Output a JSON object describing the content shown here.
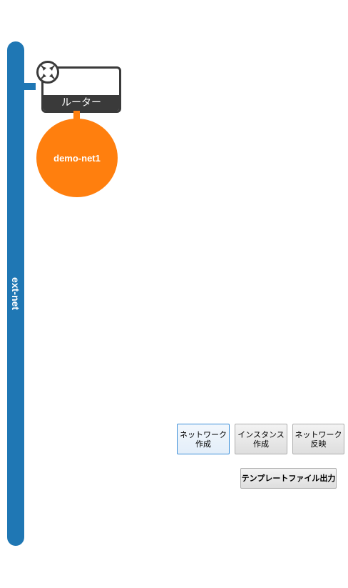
{
  "topology": {
    "external_network": {
      "name": "ext-net",
      "color": "#1f77b4"
    },
    "router": {
      "label": "ルーター",
      "icon": "router-arrows-icon"
    },
    "networks": [
      {
        "name": "demo-net1",
        "color": "#ff7f0e"
      }
    ]
  },
  "actions": {
    "create_network": {
      "line1": "ネットワーク",
      "line2": "作成"
    },
    "create_instance": {
      "line1": "インスタンス",
      "line2": "作成"
    },
    "apply_network": {
      "line1": "ネットワーク",
      "line2": "反映"
    },
    "export_template": "テンプレートファイル出力"
  }
}
